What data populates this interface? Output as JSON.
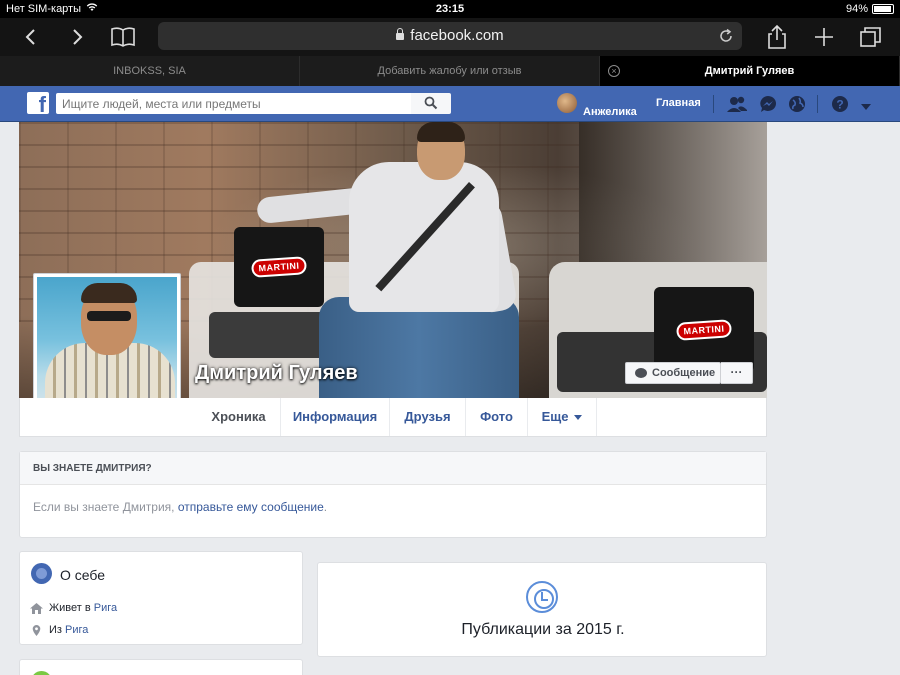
{
  "status_bar": {
    "carrier": "Нет SIM-карты",
    "time": "23:15",
    "battery": "94%",
    "battery_level": 0.94
  },
  "safari": {
    "url": "facebook.com",
    "tabs": [
      {
        "label": "INBOKSS, SIA",
        "active": false
      },
      {
        "label": "Добавить жалобу или отзыв",
        "active": false
      },
      {
        "label": "Дмитрий Гуляев",
        "active": true
      }
    ],
    "icons": {
      "back": "chevron-left-icon",
      "forward": "chevron-right-icon",
      "bookmarks": "book-icon",
      "share": "share-icon",
      "new_tab": "plus-icon",
      "tabs": "tabs-icon",
      "reload": "reload-icon"
    }
  },
  "fb_header": {
    "logo": "f",
    "search_placeholder": "Ищите людей, места или предметы",
    "user_name": "Анжелика",
    "home_label": "Главная",
    "brand_color": "#4267b2"
  },
  "profile": {
    "name": "Дмитрий Гуляев",
    "message_button": "Сообщение",
    "more_button": "···",
    "nav": [
      {
        "label": "Хроника",
        "active": true
      },
      {
        "label": "Информация",
        "active": false
      },
      {
        "label": "Друзья",
        "active": false
      },
      {
        "label": "Фото",
        "active": false
      },
      {
        "label": "Еще",
        "active": false
      }
    ],
    "cover_pillow_text": "MARTINI"
  },
  "know_box": {
    "title": "ВЫ ЗНАЕТЕ ДМИТРИЯ?",
    "text_before": "Если вы знаете Дмитрия, ",
    "link": "отправьте ему сообщение",
    "text_after": "."
  },
  "intro": {
    "title": "О себе",
    "rows": [
      {
        "icon": "home-icon",
        "prefix": "Живет в ",
        "link": "Рига"
      },
      {
        "icon": "location-pin-icon",
        "prefix": "Из ",
        "link": "Рига"
      }
    ]
  },
  "publications": {
    "title": "Публикации за 2015 г."
  }
}
